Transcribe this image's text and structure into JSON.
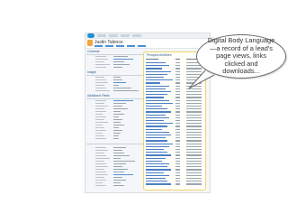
{
  "window": {
    "lead_name": "Justin Talence",
    "contents_heading": "Contents",
    "insight_heading": "Insight",
    "additional_heading": "Additional Fields"
  },
  "activity_panel": {
    "title": "Prospect Activities"
  },
  "callout": {
    "text": "Digital Body Language—a record of a lead's page views, links clicked and downloads..."
  },
  "colors": {
    "highlight_border": "#f1d56a",
    "brand_blue": "#1e8fd6",
    "avatar_orange": "#f2a440"
  }
}
